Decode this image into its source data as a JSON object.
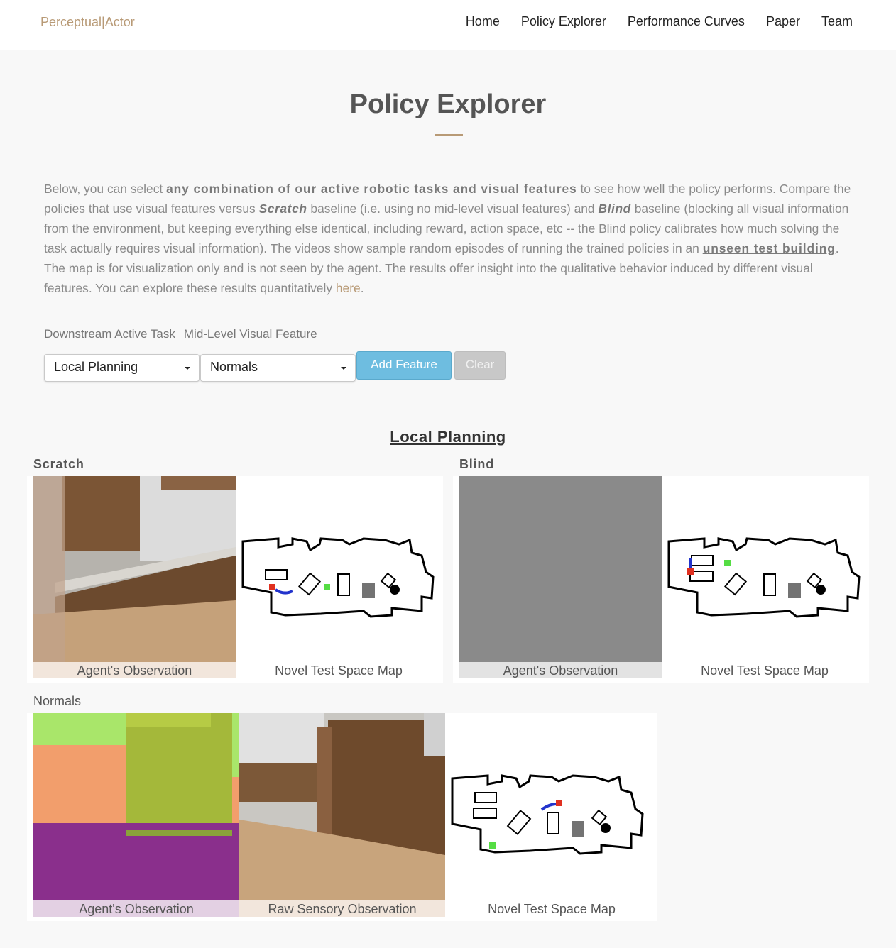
{
  "nav": {
    "brand": "Perceptual|Actor",
    "links": [
      "Home",
      "Policy Explorer",
      "Performance Curves",
      "Paper",
      "Team"
    ]
  },
  "header": {
    "title": "Policy Explorer"
  },
  "intro": {
    "p1": "Below, you can select ",
    "link1": "any combination of our active robotic tasks and visual features",
    "p2": " to see how well the policy performs. Compare the policies that use visual features versus ",
    "scratch": "Scratch",
    "p3": " baseline (i.e. using no mid-level visual features) and ",
    "blind": "Blind",
    "p4": " baseline (blocking all visual information from the environment, but keeping everything else identical, including reward, action space, etc -- the Blind policy calibrates how much solving the task actually requires visual information). The videos show sample random episodes of running the trained policies in an ",
    "link2": "unseen test building",
    "p5": ". The map is for visualization only and is not seen by the agent. The results offer insight into the qualitative behavior induced by different visual features. You can explore these results quantitatively ",
    "here": "here",
    "p6": "."
  },
  "controls": {
    "task_label": "Downstream Active Task",
    "feature_label": "Mid-Level Visual Feature",
    "task_value": "Local Planning",
    "feature_value": "Normals",
    "add_button": "Add Feature",
    "clear_button": "Clear"
  },
  "results": {
    "task_title": "Local Planning",
    "scratch": {
      "label": "Scratch",
      "obs_caption": "Agent's Observation",
      "map_caption": "Novel Test Space Map"
    },
    "blind": {
      "label": "Blind",
      "obs_caption": "Agent's Observation",
      "map_caption": "Novel Test Space Map"
    },
    "normals": {
      "label": "Normals",
      "obs_caption": "Agent's Observation",
      "raw_caption": "Raw Sensory Observation",
      "map_caption": "Novel Test Space Map"
    }
  },
  "colors": {
    "accent": "#b89a76",
    "add_button": "#6ebde0",
    "path_blue": "#2233cc",
    "start_red": "#e03020",
    "goal_green": "#55dd44"
  }
}
